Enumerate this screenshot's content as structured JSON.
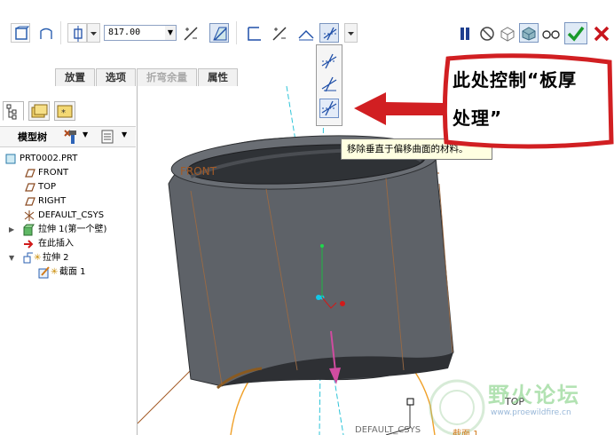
{
  "toolbar": {
    "dimension_value": "817.00",
    "tabs": [
      {
        "label": "放置"
      },
      {
        "label": "选项"
      },
      {
        "label": "折弯余量"
      },
      {
        "label": "属性"
      }
    ]
  },
  "model_tree": {
    "header_label": "模型树",
    "items": [
      {
        "label": "PRT0002.PRT"
      },
      {
        "label": "FRONT"
      },
      {
        "label": "TOP"
      },
      {
        "label": "RIGHT"
      },
      {
        "label": "DEFAULT_CSYS"
      },
      {
        "label": "拉伸 1(第一个壁)"
      },
      {
        "label": "在此插入"
      },
      {
        "label": "拉伸 2"
      },
      {
        "label": "截面 1"
      }
    ]
  },
  "viewport": {
    "front_label": "FRONT",
    "top_label": "TOP",
    "csys_label": "DEFAULT_CSYS",
    "section_label": "截面 1",
    "tooltip": "移除垂直于偏移曲面的材料。",
    "callout_line1": "此处控制“板厚",
    "callout_line2": "处理”",
    "watermark_title": "野火论坛",
    "watermark_url": "www.proewildfire.cn"
  },
  "colors": {
    "accent_blue": "#1f4fa8",
    "callout_red": "#d11f22",
    "confirm_green": "#1a9a2c",
    "cancel_red": "#c8161d",
    "model_gray": "#5e6268",
    "datum_brown": "#9a5a28"
  }
}
